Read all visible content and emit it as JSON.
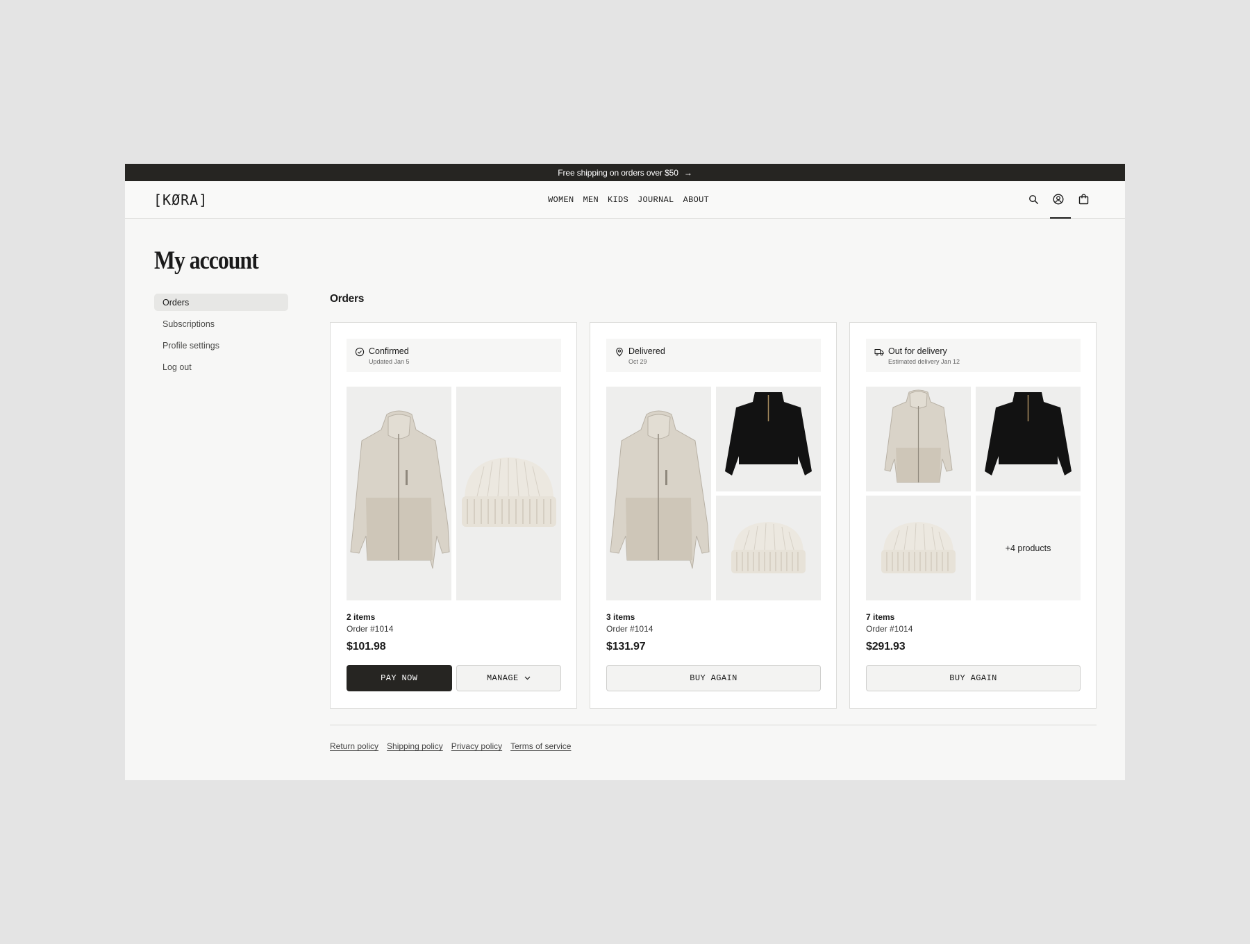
{
  "announcement": {
    "text": "Free shipping on orders over $50",
    "arrow": "→"
  },
  "header": {
    "logo": "[KØRA]",
    "nav": [
      "WOMEN",
      "MEN",
      "KIDS",
      "JOURNAL",
      "ABOUT"
    ],
    "icons": [
      "search-icon",
      "account-icon",
      "bag-icon"
    ]
  },
  "page": {
    "title": "My account"
  },
  "sidebar": {
    "items": [
      {
        "label": "Orders",
        "active": true
      },
      {
        "label": "Subscriptions"
      },
      {
        "label": "Profile settings"
      },
      {
        "label": "Log out"
      }
    ]
  },
  "orders": {
    "title": "Orders",
    "cards": [
      {
        "status": "Confirmed",
        "status_icon": "check-circle-icon",
        "sub": "Updated Jan 5",
        "items": "2 items",
        "order": "Order #1014",
        "price": "$101.98",
        "buttons": [
          {
            "label": "PAY NOW"
          },
          {
            "label": "MANAGE"
          }
        ]
      },
      {
        "status": "Delivered",
        "status_icon": "location-pin-icon",
        "sub": "Oct 29",
        "items": "3 items",
        "order": "Order #1014",
        "price": "$131.97",
        "buttons": [
          {
            "label": "BUY AGAIN"
          }
        ]
      },
      {
        "status": "Out for delivery",
        "status_icon": "delivery-truck-icon",
        "sub": "Estimated delivery Jan 12",
        "items": "7 items",
        "order": "Order #1014",
        "price": "$291.93",
        "more": "+4 products",
        "buttons": [
          {
            "label": "BUY AGAIN"
          }
        ]
      }
    ]
  },
  "footer": {
    "links": [
      "Return policy",
      "Shipping policy",
      "Privacy policy",
      "Terms of service"
    ]
  },
  "colors": {
    "dark": "#262522",
    "background": "#e4e4e4",
    "page": "#f7f7f6",
    "tile": "#eeeeed"
  }
}
